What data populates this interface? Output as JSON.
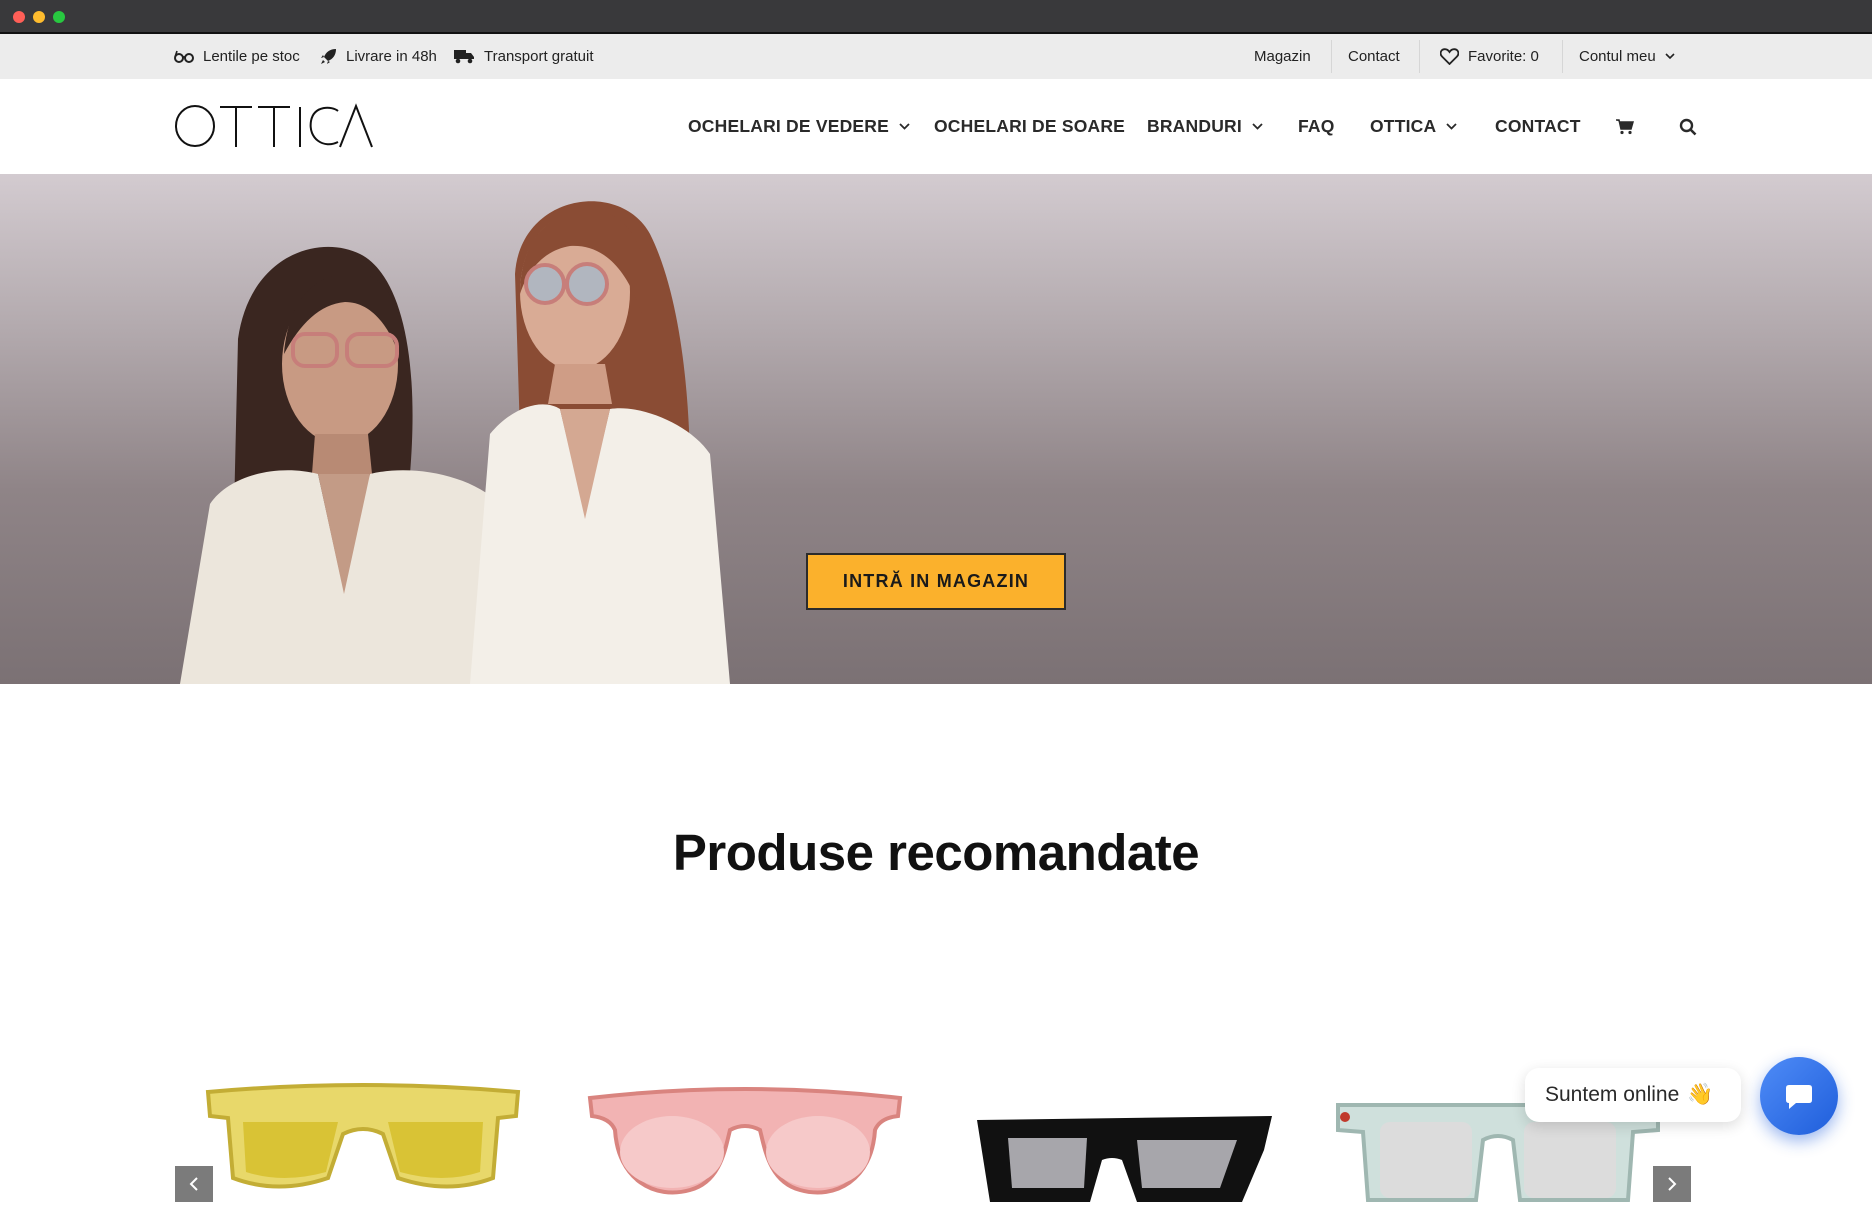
{
  "topbar": {
    "features": [
      {
        "icon": "glasses-icon",
        "label": "Lentile pe stoc"
      },
      {
        "icon": "rocket-icon",
        "label": "Livrare in 48h"
      },
      {
        "icon": "truck-icon",
        "label": "Transport gratuit"
      }
    ],
    "links": {
      "shop": "Magazin",
      "contact": "Contact",
      "favorites": "Favorite: 0",
      "account": "Contul meu"
    }
  },
  "header": {
    "logo_text": "OTTICA",
    "nav": [
      {
        "label": "OCHELARI DE VEDERE",
        "dropdown": true
      },
      {
        "label": "OCHELARI DE SOARE",
        "dropdown": false
      },
      {
        "label": "BRANDURI",
        "dropdown": true
      },
      {
        "label": "FAQ",
        "dropdown": false
      },
      {
        "label": "OTTICA",
        "dropdown": true
      },
      {
        "label": "CONTACT",
        "dropdown": false
      }
    ]
  },
  "hero": {
    "cta_label": "INTRĂ IN MAGAZIN"
  },
  "recommended": {
    "title": "Produse recomandate",
    "products": [
      {
        "icon": "glasses-yellow-image",
        "color": "#e8d86a"
      },
      {
        "icon": "glasses-pink-image",
        "color": "#f2b3b3"
      },
      {
        "icon": "glasses-black-image",
        "color": "#111111"
      },
      {
        "icon": "glasses-clear-image",
        "color": "#cfe0dc"
      }
    ]
  },
  "chat": {
    "status_text": "Suntem online",
    "emoji": "👋"
  },
  "colors": {
    "accent": "#fbb12c",
    "chat": "#2f6fe8",
    "topbar": "#ececec"
  }
}
